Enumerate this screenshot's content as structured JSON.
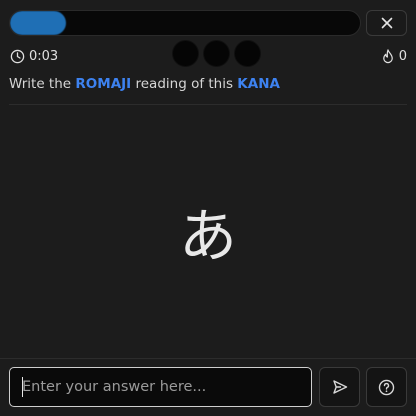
{
  "progress": {
    "fraction": 0.16,
    "color": "#1f6fb5"
  },
  "icons": {
    "close": "close-icon",
    "timer": "clock-icon",
    "streak": "flame-icon",
    "submit": "send-icon",
    "help": "help-circle-icon"
  },
  "stats": {
    "timer": "0:03",
    "lives_count": 3,
    "streak": "0"
  },
  "prompt": {
    "pre": "Write the ",
    "target": "ROMAJI",
    "mid": " reading of this ",
    "source": "KANA",
    "accent": "#3d82f0"
  },
  "question": {
    "kana": "あ"
  },
  "answer": {
    "placeholder": "Enter your answer here...",
    "value": ""
  }
}
